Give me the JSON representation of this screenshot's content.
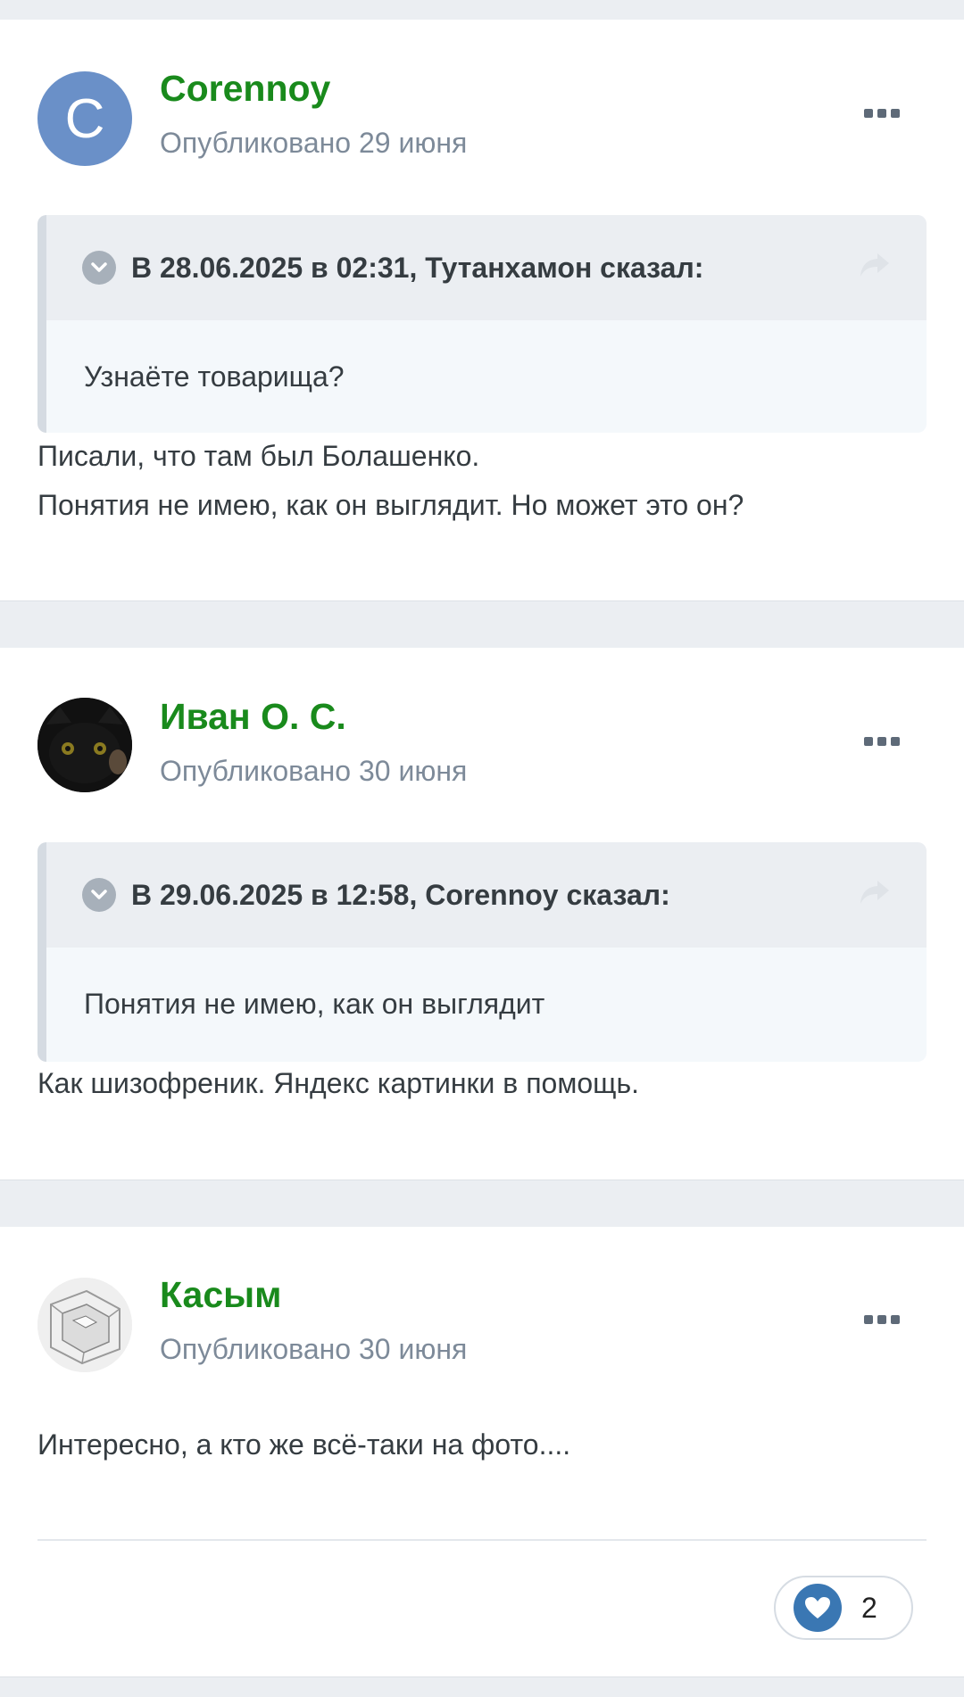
{
  "posts": [
    {
      "author": "Corennoy",
      "avatar_letter": "C",
      "date": "Опубликовано 29 июня",
      "quote": {
        "header": "В 28.06.2025 в 02:31, Тутанхамон сказал:",
        "body": "Узнаёте товарища?"
      },
      "text": [
        "Писали, что там был Болашенко.",
        "Понятия не имею, как он выглядит. Но может это он?"
      ]
    },
    {
      "author": "Иван О. С.",
      "date": "Опубликовано 30 июня",
      "quote": {
        "header": "В 29.06.2025 в 12:58, Corennoy сказал:",
        "body": "Понятия не имею, как он выглядит"
      },
      "text": [
        "Как шизофреник. Яндекс картинки в помощь."
      ]
    },
    {
      "author": "Касым",
      "date": "Опубликовано 30 июня",
      "text": [
        "Интересно, а кто же всё-таки на фото...."
      ],
      "reaction": {
        "icon": "heart-icon",
        "count": "2"
      }
    }
  ],
  "colors": {
    "author": "#198a1c",
    "date": "#7d8a99",
    "page_bg": "#ebeef2",
    "reaction": "#3a77b3"
  }
}
